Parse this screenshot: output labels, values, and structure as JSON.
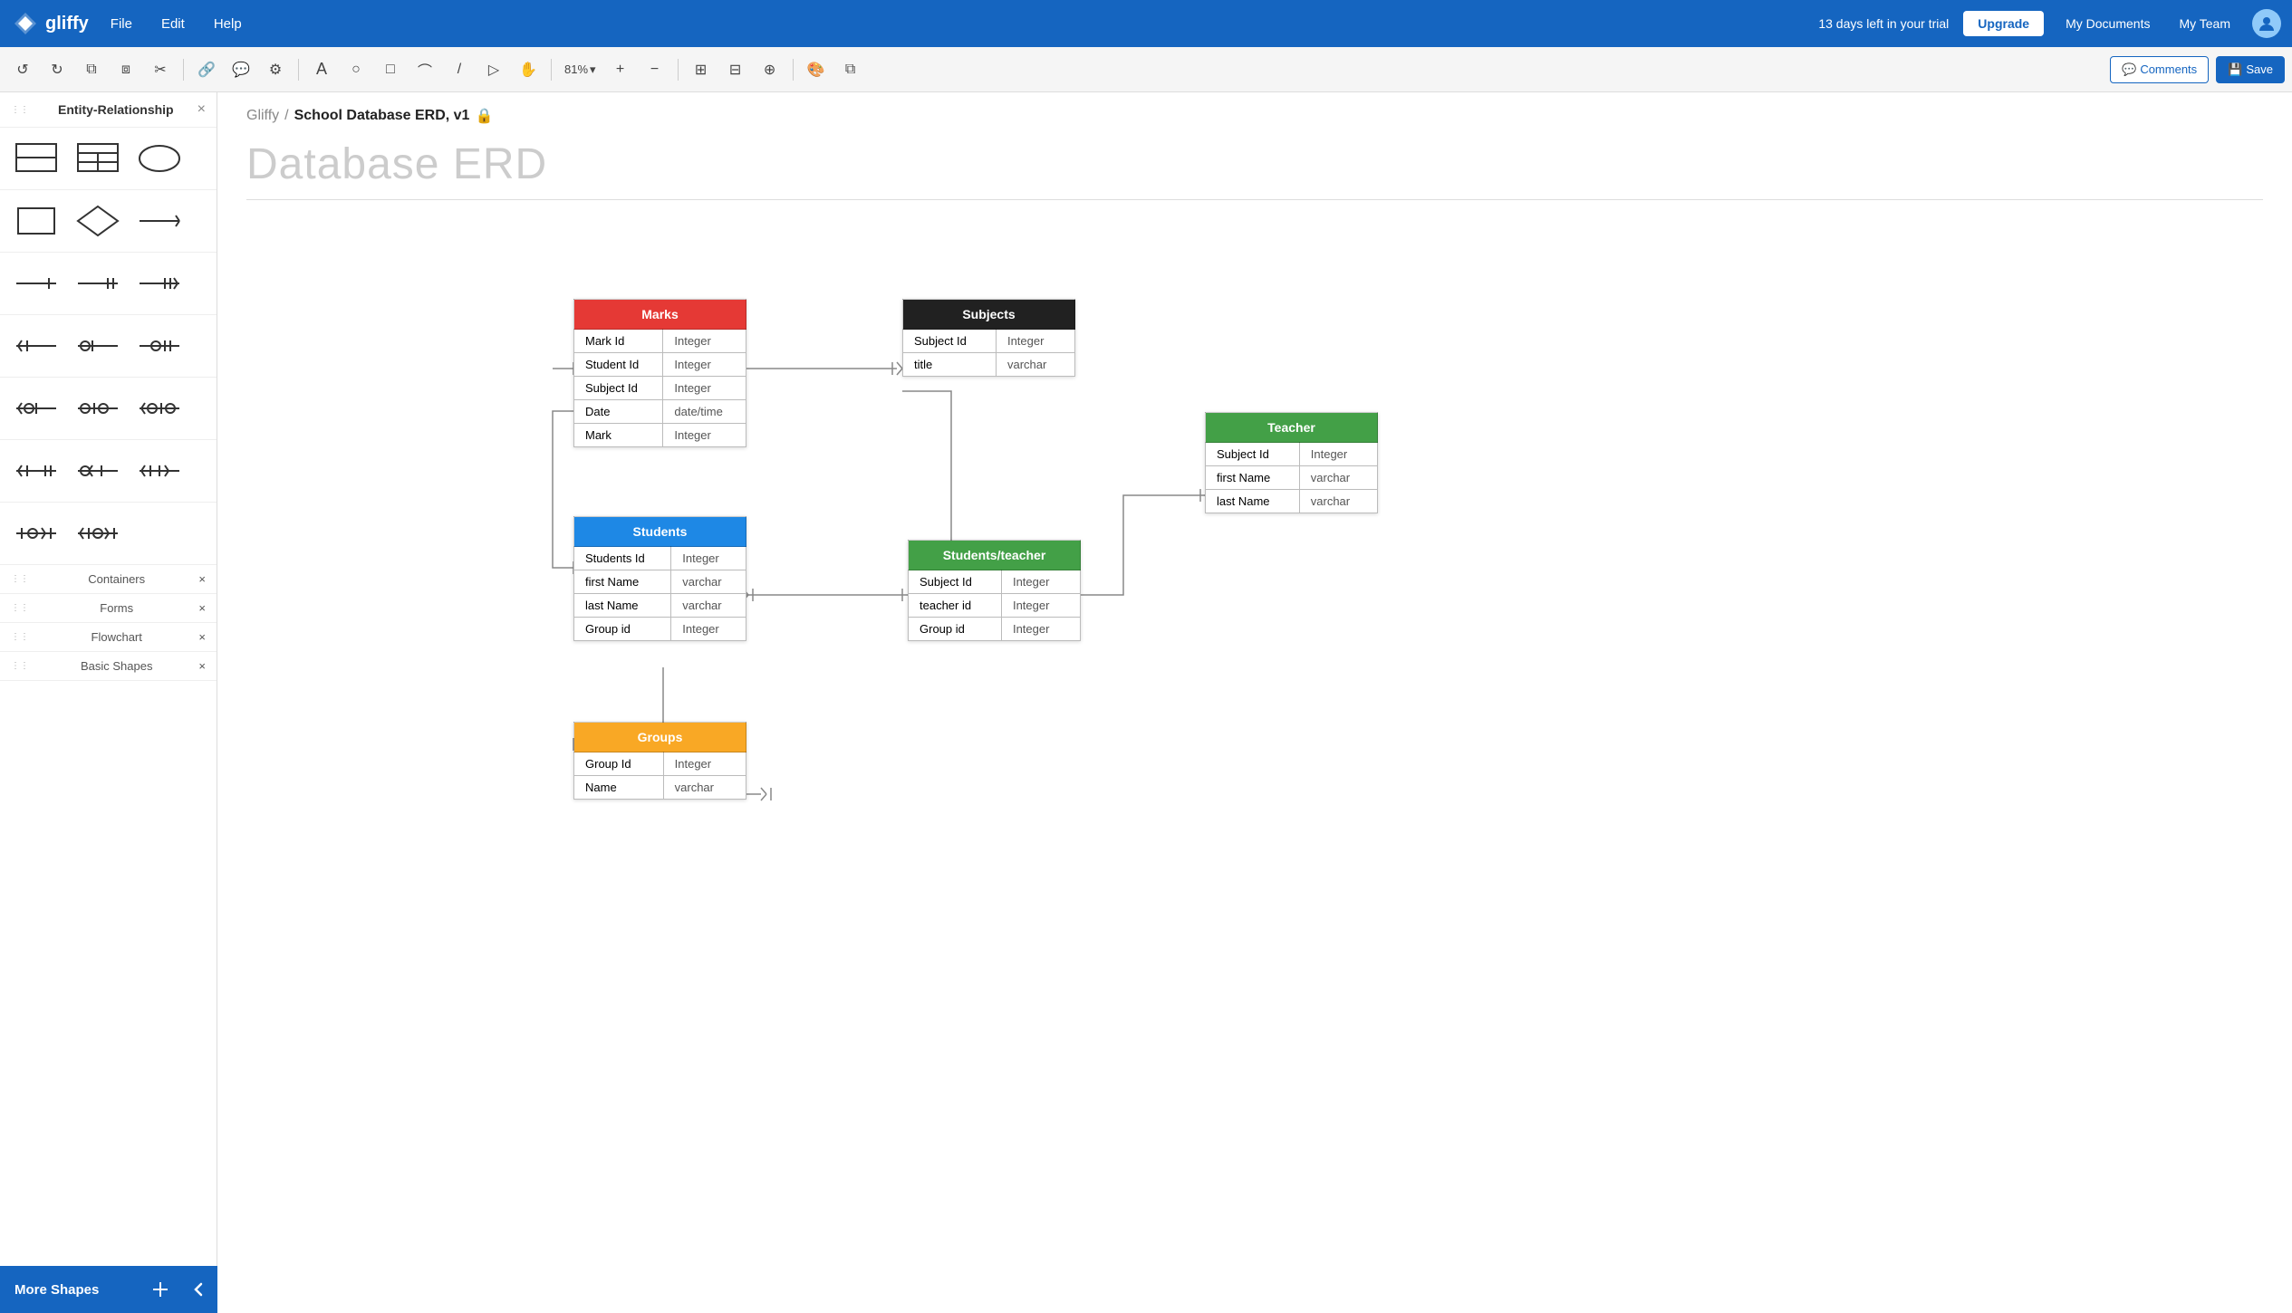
{
  "topnav": {
    "logo_text": "gliffy",
    "nav_items": [
      "File",
      "Edit",
      "Help"
    ],
    "trial_text": "13 days left in your trial",
    "upgrade_label": "Upgrade",
    "my_docs_label": "My Documents",
    "my_team_label": "My Team"
  },
  "toolbar": {
    "zoom_level": "81%",
    "comments_label": "Comments",
    "save_label": "Save"
  },
  "sidebar": {
    "header_title": "Entity-Relationship",
    "sections": [
      {
        "label": "Containers",
        "id": "containers"
      },
      {
        "label": "Forms",
        "id": "forms"
      },
      {
        "label": "Flowchart",
        "id": "flowchart"
      },
      {
        "label": "Basic Shapes",
        "id": "basic-shapes"
      }
    ]
  },
  "breadcrumb": {
    "prefix": "Gliffy",
    "separator": "/",
    "doc_title": "School Database ERD, v1"
  },
  "canvas": {
    "title": "Database ERD"
  },
  "erd_tables": {
    "marks": {
      "name": "Marks",
      "color": "#e53935",
      "rows": [
        [
          "Mark Id",
          "Integer"
        ],
        [
          "Student Id",
          "Integer"
        ],
        [
          "Subject Id",
          "Integer"
        ],
        [
          "Date",
          "date/time"
        ],
        [
          "Mark",
          "Integer"
        ]
      ]
    },
    "subjects": {
      "name": "Subjects",
      "color": "#212121",
      "rows": [
        [
          "Subject Id",
          "Integer"
        ],
        [
          "title",
          "varchar"
        ]
      ]
    },
    "students": {
      "name": "Students",
      "color": "#1e88e5",
      "rows": [
        [
          "Students Id",
          "Integer"
        ],
        [
          "first Name",
          "varchar"
        ],
        [
          "last Name",
          "varchar"
        ],
        [
          "Group id",
          "Integer"
        ]
      ]
    },
    "students_teacher": {
      "name": "Students/teacher",
      "color": "#43a047",
      "rows": [
        [
          "Subject Id",
          "Integer"
        ],
        [
          "teacher id",
          "Integer"
        ],
        [
          "Group id",
          "Integer"
        ]
      ]
    },
    "teacher": {
      "name": "Teacher",
      "color": "#43a047",
      "rows": [
        [
          "Subject Id",
          "Integer"
        ],
        [
          "first Name",
          "varchar"
        ],
        [
          "last Name",
          "varchar"
        ]
      ]
    },
    "groups": {
      "name": "Groups",
      "color": "#f9a825",
      "rows": [
        [
          "Group Id",
          "Integer"
        ],
        [
          "Name",
          "varchar"
        ]
      ]
    }
  },
  "bottom_bar": {
    "more_shapes_label": "More Shapes"
  }
}
